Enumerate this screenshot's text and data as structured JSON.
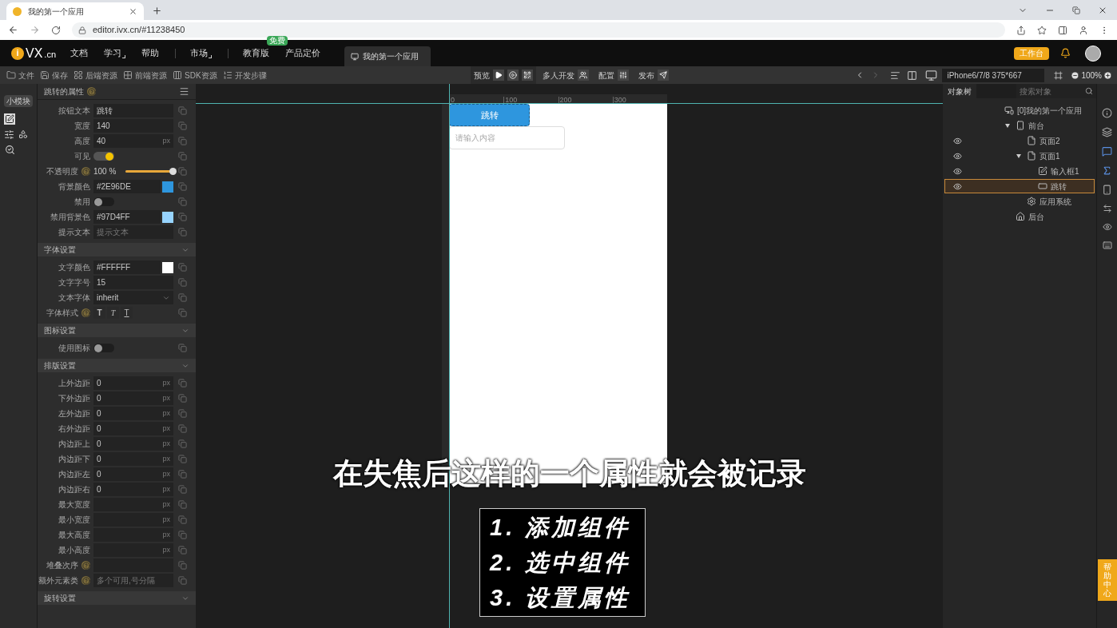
{
  "browser": {
    "tab_title": "我的第一个应用",
    "url": "editor.ivx.cn/#11238450"
  },
  "nav": {
    "logo_mark": "i",
    "logo_text": "VX",
    "logo_suffix": ".cn",
    "items": [
      {
        "label": "文档",
        "caret": false
      },
      {
        "label": "学习",
        "caret": true
      },
      {
        "label": "帮助",
        "caret": false
      },
      {
        "label": "市场",
        "caret": true
      },
      {
        "label": "教育版",
        "caret": false,
        "badge": "免费"
      },
      {
        "label": "产品定价",
        "caret": false
      }
    ],
    "doc_tab": "我的第一个应用",
    "workbench": "工作台"
  },
  "toolbar": {
    "left": [
      {
        "kind": "folder",
        "label": "文件"
      },
      {
        "kind": "save",
        "label": "保存"
      },
      {
        "kind": "grid",
        "label": "后端资源"
      },
      {
        "kind": "blocks",
        "label": "前端资源"
      },
      {
        "kind": "columns",
        "label": "SDK资源"
      },
      {
        "kind": "steps",
        "label": "开发步骤"
      }
    ],
    "preview": "预览",
    "team": "多人开发",
    "config": "配置",
    "publish": "发布",
    "device": "iPhone6/7/8 375*667",
    "zoom": "100%"
  },
  "left_strip": {
    "tab": "小模块"
  },
  "properties": {
    "title": "跳转的属性",
    "rows": [
      {
        "kind": "input",
        "label": "按钮文本",
        "value": "跳转"
      },
      {
        "kind": "input",
        "label": "宽度",
        "value": "140"
      },
      {
        "kind": "input",
        "label": "高度",
        "value": "40",
        "unit": "px"
      },
      {
        "kind": "toggle",
        "label": "可见",
        "on": true
      },
      {
        "kind": "slider",
        "label": "不透明度",
        "help": true,
        "value": "100 %",
        "level": 1
      },
      {
        "kind": "color",
        "label": "背景颜色",
        "value": "#2E96DE",
        "color": "#2e96de"
      },
      {
        "kind": "toggle",
        "label": "禁用",
        "on": false
      },
      {
        "kind": "color",
        "label": "禁用背景色",
        "value": "#97D4FF",
        "color": "#97d4ff"
      },
      {
        "kind": "input",
        "label": "提示文本",
        "placeholder": "提示文本"
      }
    ],
    "sections": [
      {
        "title": "字体设置",
        "rows": [
          {
            "kind": "color",
            "label": "文字颜色",
            "value": "#FFFFFF",
            "color": "#ffffff"
          },
          {
            "kind": "input",
            "label": "文字字号",
            "value": "15"
          },
          {
            "kind": "select",
            "label": "文本字体",
            "value": "inherit"
          },
          {
            "kind": "styles",
            "label": "字体样式",
            "help": true,
            "buttons": [
              {
                "kind": "bold",
                "glyph": "T"
              },
              {
                "kind": "italic",
                "glyph": "T"
              },
              {
                "kind": "underline",
                "glyph": "T"
              }
            ]
          }
        ]
      },
      {
        "title": "图标设置",
        "rows": [
          {
            "kind": "toggle",
            "label": "使用图标",
            "on": false
          }
        ]
      },
      {
        "title": "排版设置",
        "rows": [
          {
            "kind": "input",
            "label": "上外边距",
            "value": "0",
            "unit": "px"
          },
          {
            "kind": "input",
            "label": "下外边距",
            "value": "0",
            "unit": "px"
          },
          {
            "kind": "input",
            "label": "左外边距",
            "value": "0",
            "unit": "px"
          },
          {
            "kind": "input",
            "label": "右外边距",
            "value": "0",
            "unit": "px"
          },
          {
            "kind": "input",
            "label": "内边距上",
            "value": "0",
            "unit": "px"
          },
          {
            "kind": "input",
            "label": "内边距下",
            "value": "0",
            "unit": "px"
          },
          {
            "kind": "input",
            "label": "内边距左",
            "value": "0",
            "unit": "px"
          },
          {
            "kind": "input",
            "label": "内边距右",
            "value": "0",
            "unit": "px"
          },
          {
            "kind": "input",
            "label": "最大宽度",
            "unit": "px"
          },
          {
            "kind": "input",
            "label": "最小宽度",
            "unit": "px"
          },
          {
            "kind": "input",
            "label": "最大高度",
            "unit": "px"
          },
          {
            "kind": "input",
            "label": "最小高度",
            "unit": "px"
          },
          {
            "kind": "input",
            "label": "堆叠次序",
            "help": true
          },
          {
            "kind": "input",
            "label": "额外元素类",
            "help": true,
            "placeholder": "多个可用,号分隔"
          }
        ]
      },
      {
        "title": "旋转设置"
      }
    ]
  },
  "canvas": {
    "ruler": [
      "0",
      "100",
      "200",
      "300"
    ],
    "button": "跳转",
    "input_placeholder": "请输入内容"
  },
  "tree": {
    "tab": "对象树",
    "search_placeholder": "搜索对象",
    "nodes": [
      {
        "label": "[0]我的第一个应用",
        "kind": "app",
        "selected": false,
        "children": [
          {
            "label": "前台",
            "kind": "frontend",
            "expanded": true,
            "selected": false,
            "children": [
              {
                "label": "页面2",
                "kind": "page",
                "visible": true,
                "selected": false
              },
              {
                "label": "页面1",
                "kind": "page",
                "visible": true,
                "expanded": true,
                "selected": false,
                "children": [
                  {
                    "label": "输入框1",
                    "kind": "input",
                    "visible": true,
                    "selected": false
                  },
                  {
                    "label": "跳转",
                    "kind": "button",
                    "visible": true,
                    "selected": true
                  }
                ]
              },
              {
                "label": "应用系统",
                "kind": "system",
                "selected": false
              }
            ]
          },
          {
            "label": "后台",
            "kind": "backend",
            "selected": false
          }
        ]
      }
    ]
  },
  "subtitle": "在失焦后这样的一个属性就会被记录",
  "steps": [
    "1. 添加组件",
    "2. 选中组件",
    "3. 设置属性"
  ],
  "help_tab": "帮助中心"
}
